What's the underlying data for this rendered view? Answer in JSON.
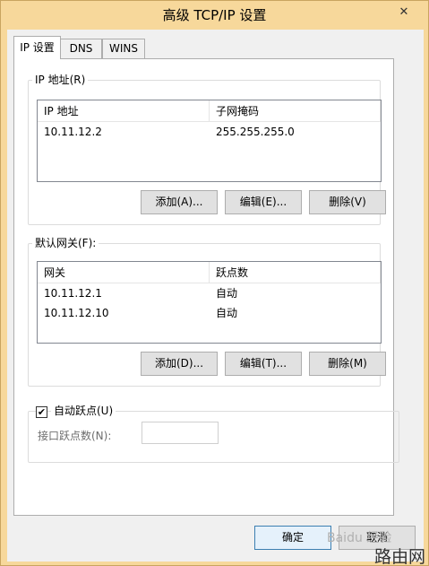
{
  "window": {
    "title": "高级 TCP/IP 设置",
    "close_glyph": "✕"
  },
  "tabs": [
    {
      "label": "IP 设置",
      "active": true
    },
    {
      "label": "DNS",
      "active": false
    },
    {
      "label": "WINS",
      "active": false
    }
  ],
  "ip_group": {
    "title": "IP 地址(R)",
    "columns": [
      "IP 地址",
      "子网掩码"
    ],
    "rows": [
      {
        "ip": "10.11.12.2",
        "mask": "255.255.255.0"
      }
    ],
    "add_label": "添加(A)...",
    "edit_label": "编辑(E)...",
    "delete_label": "删除(V)"
  },
  "gateway_group": {
    "title": "默认网关(F):",
    "columns": [
      "网关",
      "跃点数"
    ],
    "rows": [
      {
        "gateway": "10.11.12.1",
        "metric": "自动"
      },
      {
        "gateway": "10.11.12.10",
        "metric": "自动"
      }
    ],
    "add_label": "添加(D)...",
    "edit_label": "编辑(T)...",
    "delete_label": "删除(M)"
  },
  "metric_group": {
    "auto_metric_label": "自动跃点(U)",
    "auto_metric_checked": true,
    "check_glyph": "✔",
    "interface_metric_label": "接口跃点数(N):",
    "interface_metric_value": ""
  },
  "footer": {
    "ok_label": "确定",
    "cancel_label": "取消"
  },
  "watermarks": {
    "baidu": "Baidu 经验",
    "site": "路由网"
  }
}
